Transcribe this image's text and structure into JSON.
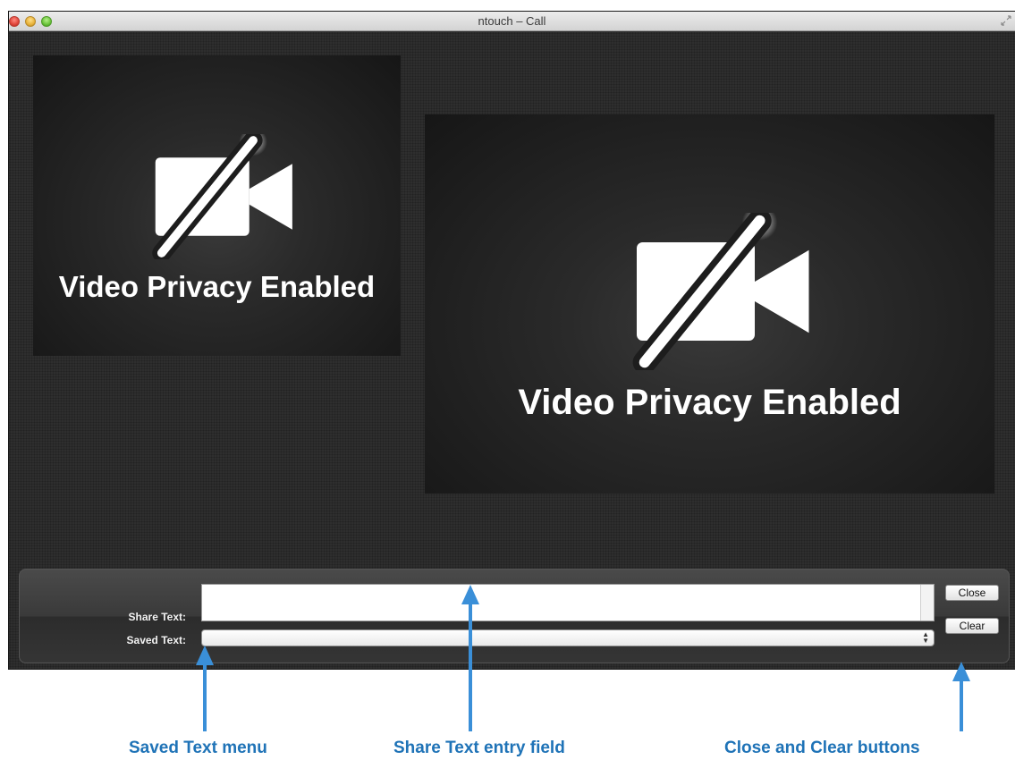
{
  "window": {
    "title": "ntouch – Call"
  },
  "video": {
    "self_text": "Video Privacy Enabled",
    "remote_text": "Video Privacy Enabled",
    "icon": "video-off-icon"
  },
  "share_panel": {
    "share_label": "Share Text:",
    "share_value": "",
    "saved_label": "Saved Text:",
    "saved_selected": "",
    "close_label": "Close",
    "clear_label": "Clear"
  },
  "annotations": {
    "saved_text_menu": "Saved Text menu",
    "share_text_field": "Share Text entry field",
    "close_clear_buttons": "Close and Clear buttons"
  },
  "colors": {
    "annotation_blue": "#1f73b7",
    "arrow_blue": "#3a8fd8"
  }
}
